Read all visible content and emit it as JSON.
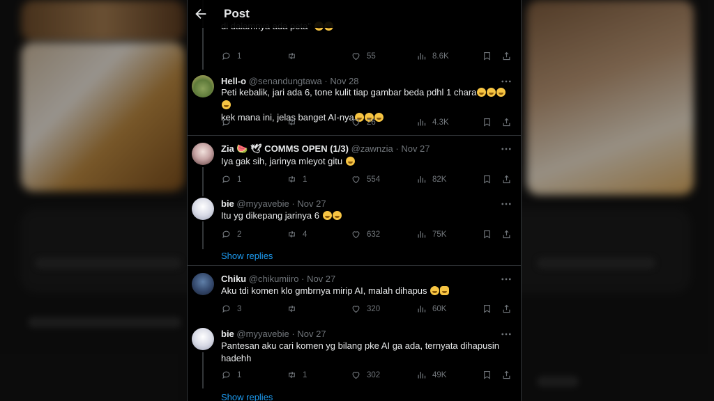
{
  "page": {
    "title": "Post"
  },
  "posts": [
    {
      "text": "di dalamnya ada peta\"",
      "emoji_count": 2,
      "reply": "1",
      "retweet": "",
      "like": "55",
      "views": "8.6K"
    },
    {
      "name": "Hell-o",
      "handle": "@senandungtawa",
      "date": "Nov 28",
      "line1": "Peti kebalik, jari ada 6, tone kulit tiap gambar beda pdhl 1 chara",
      "line2": "kek mana ini, jelas banget AI-nya",
      "reply": "",
      "retweet": "",
      "like": "26",
      "views": "4.3K"
    },
    {
      "name": "Zia 🍉 🕊 COMMS OPEN (1/3)",
      "handle": "@zawnzia",
      "date": "Nov 27",
      "text": "Iya gak sih, jarinya mleyot gitu",
      "reply": "1",
      "retweet": "1",
      "like": "554",
      "views": "82K"
    },
    {
      "name": "bie",
      "handle": "@myyavebie",
      "date": "Nov 27",
      "text": "Itu yg dikepang jarinya 6",
      "reply": "2",
      "retweet": "4",
      "like": "632",
      "views": "75K",
      "show_replies": "Show replies"
    },
    {
      "name": "Chiku",
      "handle": "@chikumiiro",
      "date": "Nov 27",
      "text": "Aku tdi komen klo gmbrnya mirip AI, malah dihapus",
      "reply": "3",
      "retweet": "",
      "like": "320",
      "views": "60K"
    },
    {
      "name": "bie",
      "handle": "@myyavebie",
      "date": "Nov 27",
      "line1": "Pantesan aku cari komen yg bilang pke AI ga ada, ternyata dihapusin",
      "line2": "hadehh",
      "reply": "1",
      "retweet": "1",
      "like": "302",
      "views": "49K",
      "show_replies": "Show replies"
    }
  ],
  "colors": {
    "accent": "#1d9bf0",
    "muted": "#71767b",
    "text": "#e7e9ea",
    "border": "#2f3336"
  },
  "icons": [
    "back-arrow-icon",
    "reply-icon",
    "retweet-icon",
    "like-icon",
    "views-icon",
    "bookmark-icon",
    "share-icon",
    "more-icon"
  ]
}
